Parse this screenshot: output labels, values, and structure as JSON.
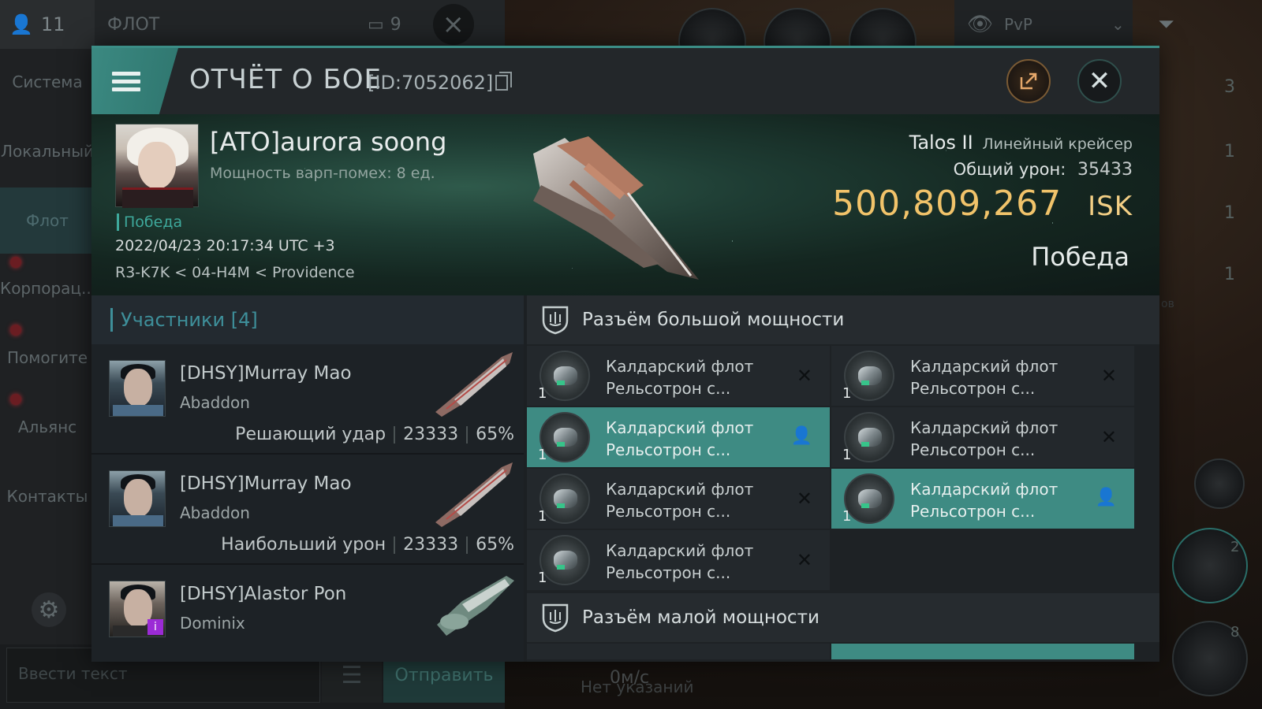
{
  "background": {
    "chat": {
      "user_count": "11",
      "channel_label": "ФЛОТ",
      "member_count": "9",
      "nav": [
        "Система",
        "Локальный",
        "Флот",
        "Корпорац...",
        "Помогите",
        "Альянс",
        "Контакты"
      ],
      "input_placeholder": "Ввести текст",
      "send_label": "Отправить"
    },
    "hud": {
      "mode": "PvP",
      "side_counts": [
        "3",
        "1",
        "1",
        "1"
      ],
      "speed": "0м/с",
      "hint": "Нет указаний",
      "ship_count_a": "2",
      "ship_count_b": "8",
      "side_text": "ов"
    }
  },
  "report": {
    "title": "ОТЧЁТ О БОЕ",
    "id": "[ID:7052062]",
    "victim": {
      "name": "[ATO]aurora soong",
      "warp_disruption": "Мощность варп-помех: 8 ед.",
      "outcome_tag": "Победа",
      "datetime": "2022/04/23 20:17:34 UTC +3",
      "location": "R3-K7K < 04-H4M < Providence",
      "ship_name": "Talos II",
      "ship_class": "Линейный крейсер",
      "total_damage_label": "Общий урон:",
      "total_damage": "35433",
      "isk_value": "500,809,267",
      "isk_unit": "ISK",
      "result": "Победа"
    },
    "participants_header": "Участники [4]",
    "participants": [
      {
        "name": "[DHSY]Murray Mao",
        "ship": "Abaddon",
        "role": "Решающий удар",
        "damage": "23333",
        "percent": "65%"
      },
      {
        "name": "[DHSY]Murray Mao",
        "ship": "Abaddon",
        "role": "Наибольший урон",
        "damage": "23333",
        "percent": "65%"
      },
      {
        "name": "[DHSY]Alastor Pon",
        "ship": "Dominix",
        "role": "",
        "damage": "",
        "percent": ""
      }
    ],
    "high_slot_header": "Разъём большой мощности",
    "low_slot_header": "Разъём малой мощности",
    "high_slots": [
      {
        "line1": "Калдарский флот",
        "line2": "Рельсотрон с...",
        "qty": "1",
        "highlight": false
      },
      {
        "line1": "Калдарский флот",
        "line2": "Рельсотрон с...",
        "qty": "1",
        "highlight": false
      },
      {
        "line1": "Калдарский флот",
        "line2": "Рельсотрон с...",
        "qty": "1",
        "highlight": true
      },
      {
        "line1": "Калдарский флот",
        "line2": "Рельсотрон с...",
        "qty": "1",
        "highlight": false
      },
      {
        "line1": "Калдарский флот",
        "line2": "Рельсотрон с...",
        "qty": "1",
        "highlight": false
      },
      {
        "line1": "Калдарский флот",
        "line2": "Рельсотрон с...",
        "qty": "1",
        "highlight": true
      },
      {
        "line1": "Калдарский флот",
        "line2": "Рельсотрон с...",
        "qty": "1",
        "highlight": false
      }
    ]
  },
  "colors": {
    "accent": "#3e8b83",
    "isk_gold": "#f1c36a",
    "participants_title": "#3e8f9a"
  }
}
